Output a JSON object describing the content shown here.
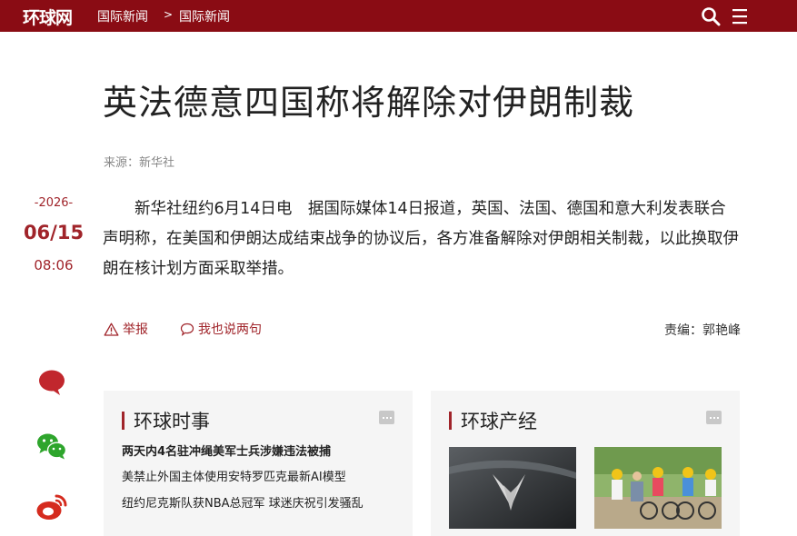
{
  "header": {
    "logo": "环球网",
    "breadcrumb": [
      "国际新闻",
      "国际新闻"
    ],
    "breadcrumb_sep": ">",
    "icons": [
      "search-icon",
      "menu-icon"
    ],
    "brand_color": "#8a0c14"
  },
  "article": {
    "title": "英法德意四国称将解除对伊朗制裁",
    "source": "来源：新华社",
    "date": {
      "year": "-2026-",
      "month_day": "06/15",
      "time": "08:06"
    },
    "body": "新华社纽约6月14日电　据国际媒体14日报道，英国、法国、德国和意大利发表联合声明称，在美国和伊朗达成结束战争的协议后，各方准备解除对伊朗相关制裁，以此换取伊朗在核计划方面采取举措。",
    "actions": {
      "report": "举报",
      "comment": "我也说两句"
    },
    "editor": "责编：郭艳峰"
  },
  "share_icons": [
    "comment-bubble-icon",
    "wechat-icon",
    "weibo-icon"
  ],
  "panels": [
    {
      "title": "环球时事",
      "items": [
        "两天内4名驻冲绳美军士兵涉嫌违法被捕",
        "美禁止外国主体使用安特罗匹克最新AI模型",
        "纽约尼克斯队获NBA总冠军 球迷庆祝引发骚乱"
      ]
    },
    {
      "title": "环球产经",
      "items": []
    }
  ]
}
